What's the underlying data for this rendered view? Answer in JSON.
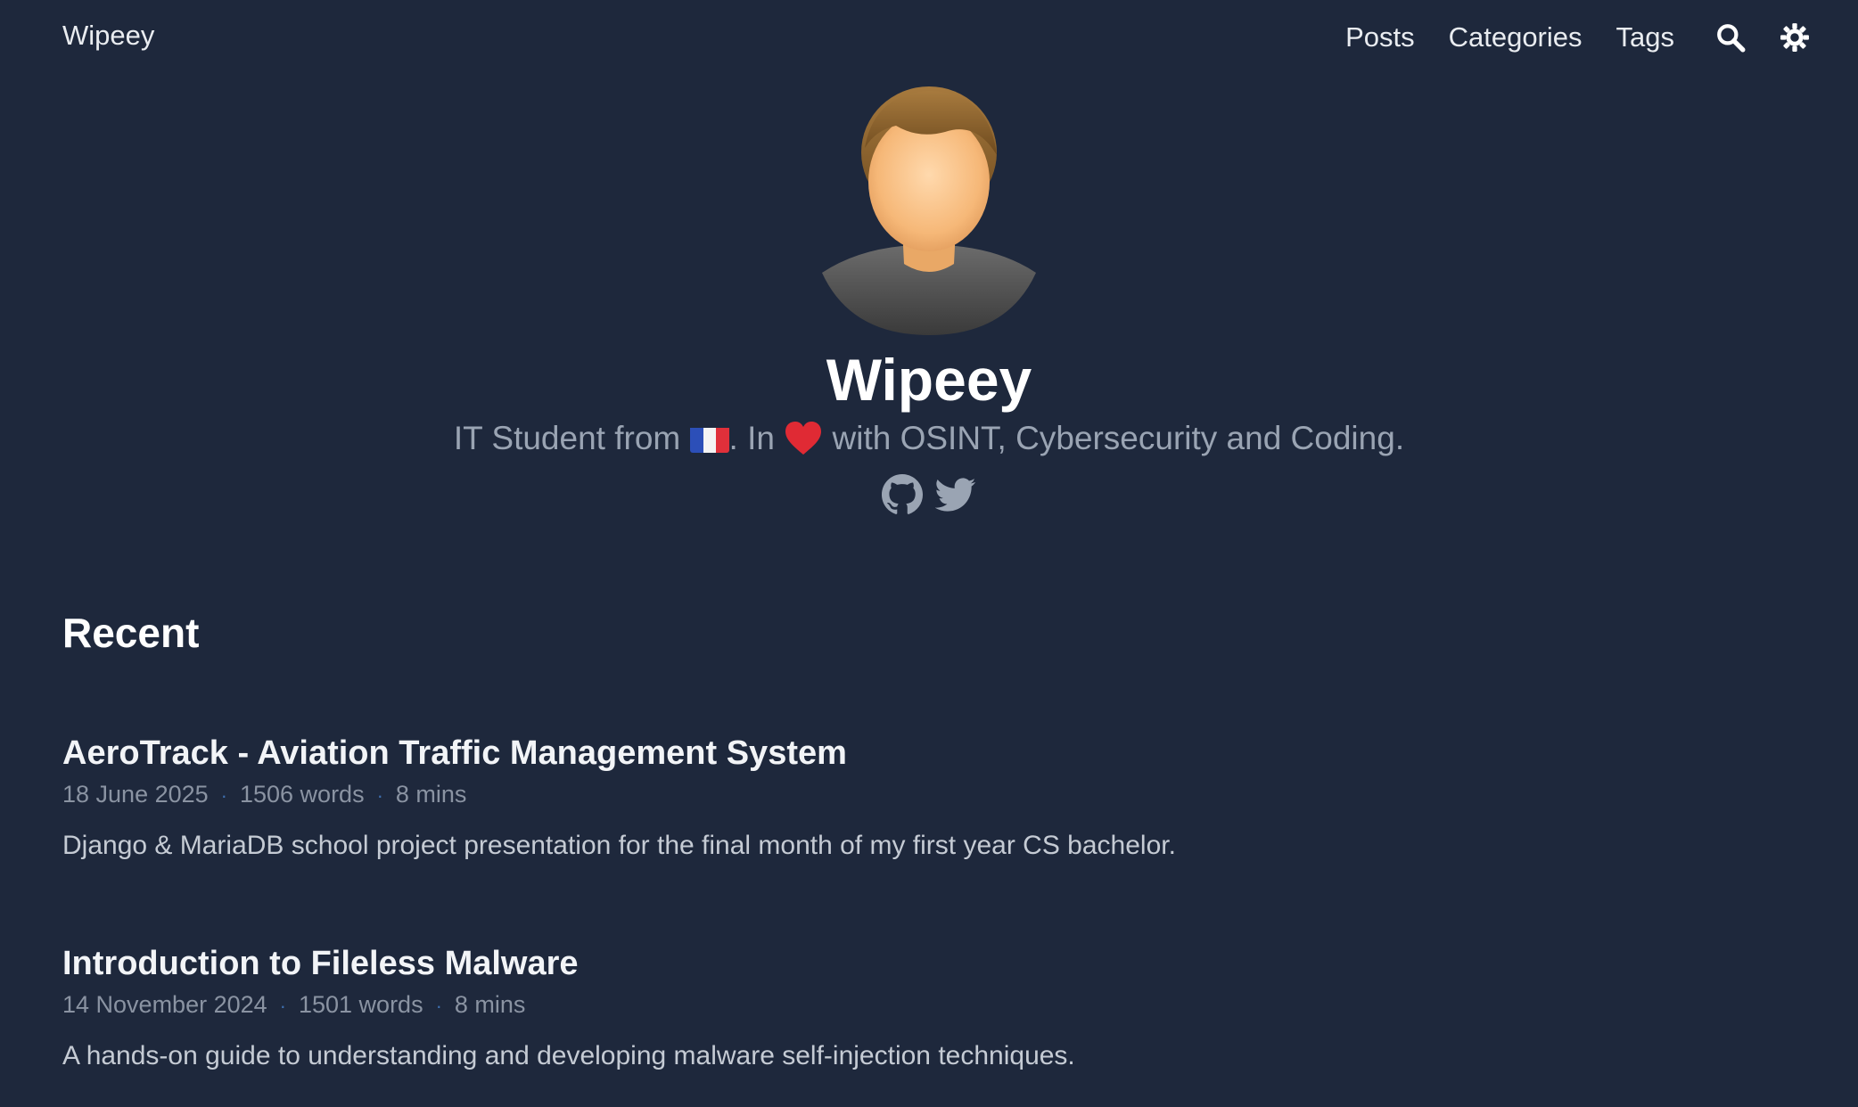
{
  "nav": {
    "brand": "Wipeey",
    "links": [
      "Posts",
      "Categories",
      "Tags"
    ],
    "icons": [
      "search-icon",
      "theme-toggle-icon"
    ]
  },
  "profile": {
    "name": "Wipeey",
    "bio_part1": "IT Student from",
    "bio_part2": ". In",
    "bio_part3": "with OSINT, Cybersecurity and Coding.",
    "social_icons": [
      "github-icon",
      "twitter-icon"
    ]
  },
  "recent": {
    "heading": "Recent",
    "posts": [
      {
        "title": "AeroTrack - Aviation Traffic Management System",
        "date": "18 June 2025",
        "words": "1506 words",
        "reading_time": "8 mins",
        "summary": "Django & MariaDB school project presentation for the final month of my first year CS bachelor."
      },
      {
        "title": "Introduction to Fileless Malware",
        "date": "14 November 2024",
        "words": "1501 words",
        "reading_time": "8 mins",
        "summary": "A hands-on guide to understanding and developing malware self-injection techniques."
      }
    ],
    "meta_separator": "·"
  },
  "colors": {
    "background": "#1e283c",
    "accent": "#3f6fb0",
    "muted_text": "#9aa4b3"
  }
}
